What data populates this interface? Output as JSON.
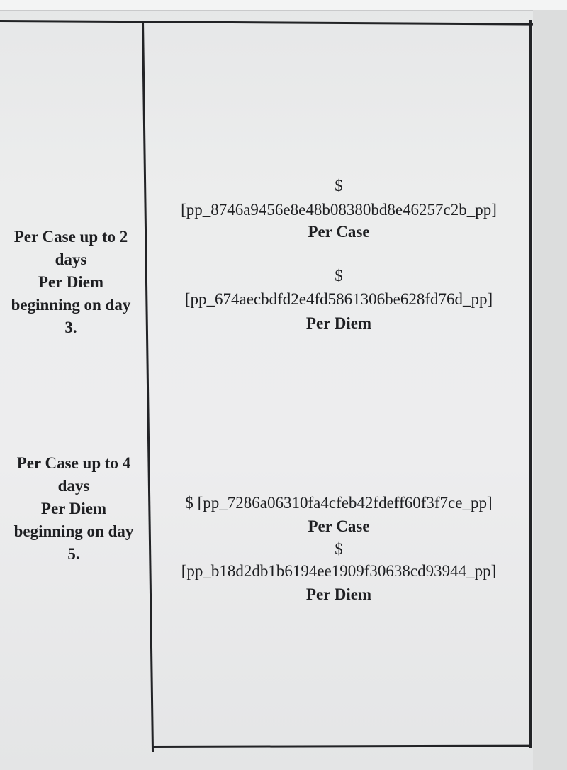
{
  "rows": [
    {
      "duration": {
        "line1": "Per Case up to 2",
        "line2": "days",
        "line3": "Per Diem",
        "line4": "beginning on day",
        "line5": "3."
      },
      "rates": {
        "currency1": "$",
        "code1": "[pp_8746a9456e8e48b08380bd8e46257c2b_pp]",
        "unit1": "Per Case",
        "currency2": "$",
        "code2": "[pp_674aecbdfd2e4fd5861306be628fd76d_pp]",
        "unit2": "Per Diem"
      }
    },
    {
      "duration": {
        "line1": "Per Case up to 4",
        "line2": "days",
        "line3": "Per Diem",
        "line4": "beginning on day",
        "line5": "5."
      },
      "rates": {
        "line1": "$ [pp_7286a06310fa4cfeb42fdeff60f3f7ce_pp]",
        "unit1": "Per Case",
        "currency2": "$",
        "code2": "[pp_b18d2db1b6194ee1909f30638cd93944_pp]",
        "unit2": "Per Diem"
      }
    }
  ]
}
